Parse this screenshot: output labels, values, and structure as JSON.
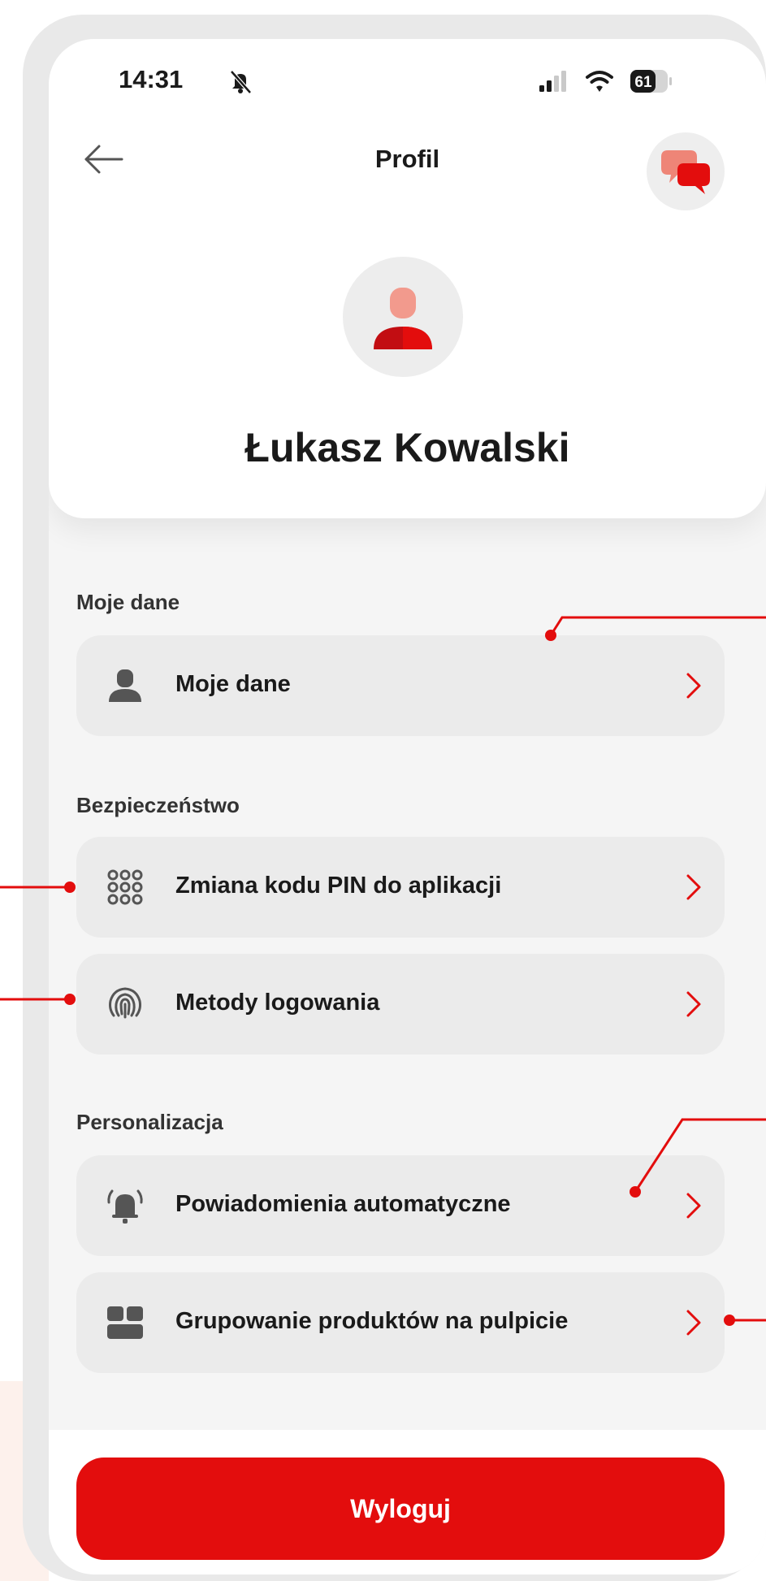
{
  "status_bar": {
    "time": "14:31",
    "battery": "61"
  },
  "nav": {
    "title": "Profil"
  },
  "profile": {
    "name": "Łukasz Kowalski"
  },
  "sections": [
    {
      "label": "Moje dane"
    },
    {
      "label": "Bezpieczeństwo"
    },
    {
      "label": "Personalizacja"
    }
  ],
  "menu": {
    "my_data": "Moje dane",
    "pin_change": "Zmiana kodu PIN do aplikacji",
    "login_methods": "Metody logowania",
    "notifications": "Powiadomienia automatyczne",
    "grouping": "Grupowanie produktów na pulpicie"
  },
  "actions": {
    "logout": "Wyloguj"
  },
  "icons": {
    "back": "arrow-left-icon",
    "chat": "chat-bubbles-icon",
    "avatar": "user-avatar-icon",
    "my_data": "person-icon",
    "pin": "keypad-icon",
    "login": "fingerprint-icon",
    "notifications": "alarm-bell-icon",
    "grouping": "grid-tiles-icon",
    "chevron": "chevron-right-icon"
  },
  "colors": {
    "accent": "#e30d0d",
    "callout": "#e30d0d",
    "card": "#ebebeb",
    "background": "#f5f5f5"
  }
}
